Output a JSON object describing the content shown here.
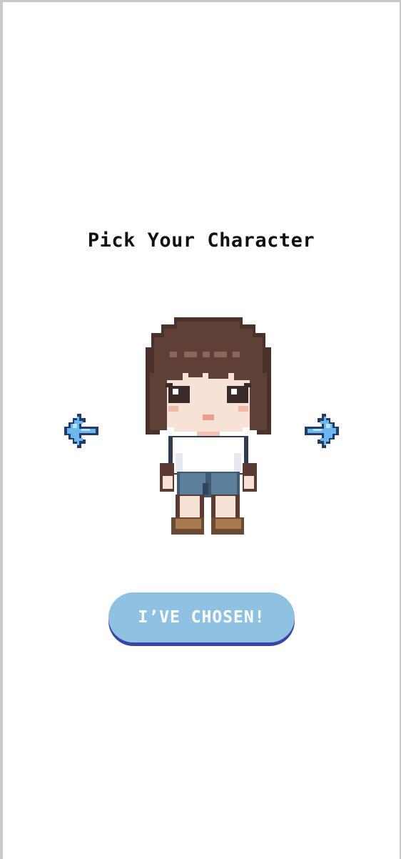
{
  "screen": {
    "title": "Pick Your Character",
    "confirm_button_label": "I’VE CHOSEN!"
  },
  "controls": {
    "previous_icon": "pixel-arrow-left-icon",
    "next_icon": "pixel-arrow-right-icon"
  },
  "character": {
    "icon": "pixel-girl-character",
    "hair_color": "#5a3d33",
    "shirt_color": "#ffffff",
    "shorts_color": "#5c7f9c",
    "shoe_color": "#a87a4e"
  },
  "colors": {
    "button_fill": "#8fc2e2",
    "button_shadow": "#3a46a6",
    "arrow_fill": "#6ab8ee",
    "arrow_outline": "#243a6a"
  }
}
